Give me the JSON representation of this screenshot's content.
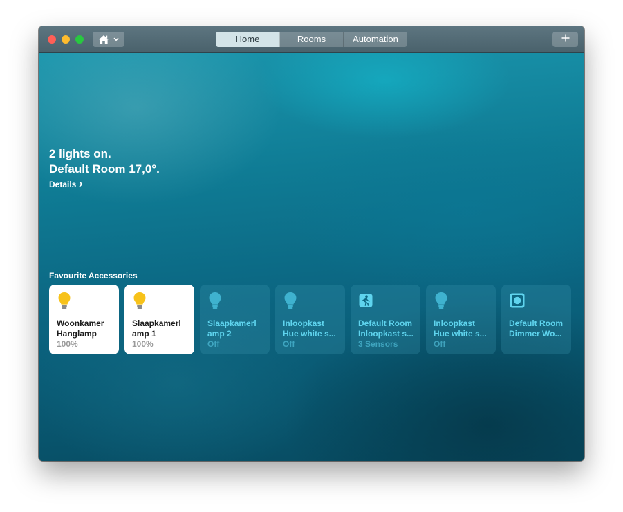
{
  "window": {
    "tabs": [
      {
        "label": "Home",
        "active": true
      },
      {
        "label": "Rooms",
        "active": false
      },
      {
        "label": "Automation",
        "active": false
      }
    ],
    "home_icon": "house-icon",
    "add_icon": "plus-icon"
  },
  "summary": {
    "line1": "2 lights on.",
    "line2": "Default Room 17,0°.",
    "details_label": "Details"
  },
  "favourites": {
    "title": "Favourite Accessories",
    "tiles": [
      {
        "line1": "Woonkamer",
        "line2": "Hanglamp",
        "status": "100%",
        "on": true,
        "icon": "lightbulb-icon"
      },
      {
        "line1": "Slaapkamerl",
        "line2": "amp 1",
        "status": "100%",
        "on": true,
        "icon": "lightbulb-icon"
      },
      {
        "line1": "Slaapkamerl",
        "line2": "amp 2",
        "status": "Off",
        "on": false,
        "icon": "lightbulb-icon"
      },
      {
        "line1": "Inloopkast",
        "line2": "Hue white s...",
        "status": "Off",
        "on": false,
        "icon": "lightbulb-icon"
      },
      {
        "line1": "Default Room",
        "line2": "Inloopkast s...",
        "status": "3 Sensors",
        "on": false,
        "icon": "motion-sensor-icon"
      },
      {
        "line1": "Inloopkast",
        "line2": "Hue white s...",
        "status": "Off",
        "on": false,
        "icon": "lightbulb-icon"
      },
      {
        "line1": "Default Room",
        "line2": "Dimmer Wo...",
        "status": "",
        "on": false,
        "icon": "dimmer-switch-icon"
      }
    ]
  },
  "colors": {
    "bulb_on": "#f7c21a",
    "tile_off_text": "#5fd4ee"
  }
}
